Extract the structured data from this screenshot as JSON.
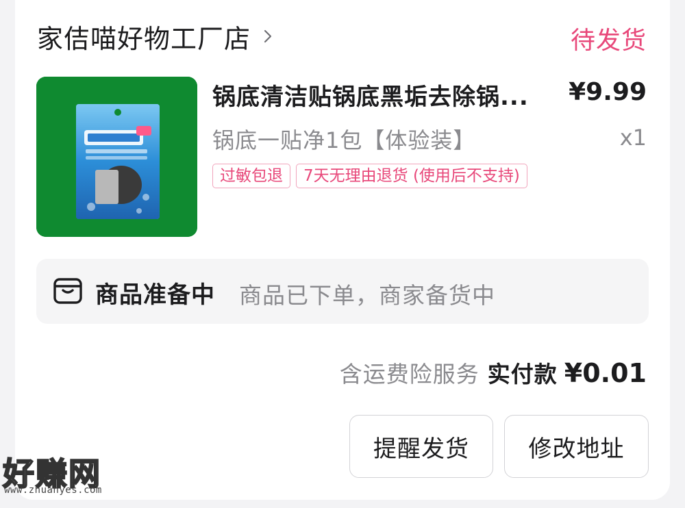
{
  "order": {
    "shop_name": "家佶喵好物工厂店",
    "status": "待发货",
    "product": {
      "title": "锅底清洁贴锅底黑垢去除锅...",
      "price": "¥9.99",
      "variant": "锅底一贴净1包【体验装】",
      "quantity": "x1",
      "tags": [
        "过敏包退",
        "7天无理由退货 (使用后不支持)"
      ],
      "image_icon": "product-package-image"
    },
    "progress": {
      "icon": "package-box-icon",
      "title": "商品准备中",
      "description": "商品已下单，商家备货中"
    },
    "payment": {
      "insurance": "含运费险服务",
      "paid_label": "实付款",
      "paid_value": "¥0.01"
    },
    "buttons": {
      "remind": "提醒发货",
      "change_address": "修改地址"
    }
  },
  "watermark": {
    "main": "好赚网",
    "url": "www.zhuanyes.com"
  },
  "colors": {
    "accent": "#e8487a",
    "tag_border": "#f1a3bb",
    "muted_text": "#8a8a8e",
    "thumb_bg": "#0f8a30"
  }
}
